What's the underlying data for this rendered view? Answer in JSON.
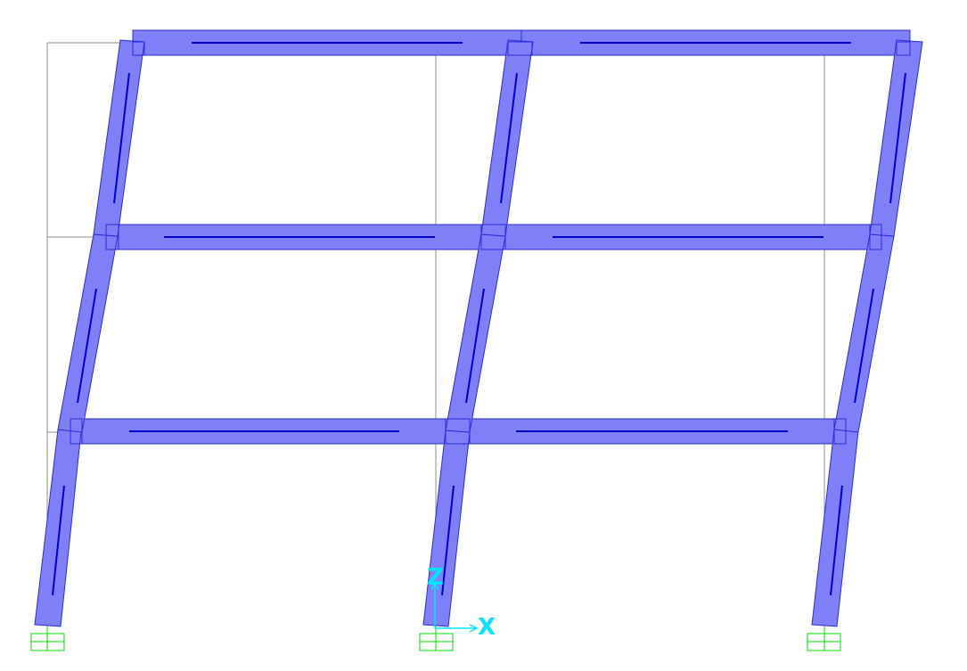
{
  "view": {
    "background": "#ffffff",
    "undeformed_grid_color": "#8c8c8c",
    "member_fill_color": "#7f7ff7",
    "member_edge_color": "#2b2bd8",
    "centerline_color": "#0000c8",
    "support_color": "#00dd00",
    "axis_color": "#00e5ff",
    "axis_labels": {
      "vertical": "Z",
      "horizontal": "X"
    }
  }
}
